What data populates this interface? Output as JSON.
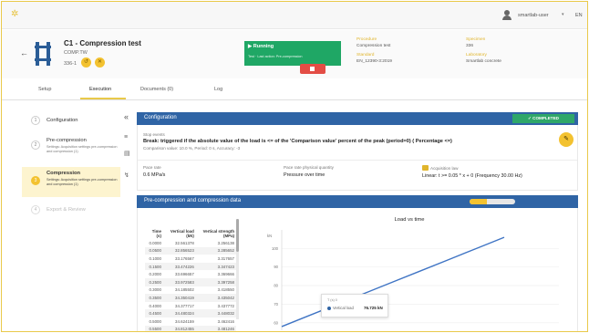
{
  "topbar": {
    "user": "smartlab-user",
    "lang": "EN"
  },
  "test": {
    "title": "C1 - Compression test",
    "code": "COMP.TW",
    "id": "336-1"
  },
  "run": {
    "state": "Running",
    "detail": "Test · Last action: Pre-compression",
    "color": "#1fa765"
  },
  "meta": [
    {
      "key": "Procedure",
      "value": "Compression test"
    },
    {
      "key": "Standard",
      "value": "EN_12390-3:2019"
    },
    {
      "key": "Specimen",
      "value": "336"
    },
    {
      "key": "Laboratory",
      "value": "Smartlab concrete"
    }
  ],
  "tabs": [
    {
      "label": "Setup"
    },
    {
      "label": "Execution"
    },
    {
      "label": "Documents (0)"
    },
    {
      "label": "Log"
    }
  ],
  "steps": [
    {
      "num": "1",
      "label": "Configuration",
      "desc": ""
    },
    {
      "num": "2",
      "label": "Pre-compression",
      "desc": "Settings: Acquisition settings pre-compression and compression (1)"
    },
    {
      "num": "3",
      "label": "Compression",
      "desc": "Settings: Acquisition settings pre-compression and compression (1)"
    },
    {
      "num": "4",
      "label": "Export & Review",
      "desc": ""
    }
  ],
  "config": {
    "header": "Configuration",
    "status": "COMPLETED",
    "stop_events_label": "Stop events",
    "stop_events_value": "Break: triggered if the absolute value of the load is <= of the 'Comparison value' percent of the peak (period=0) ( Percentage <=)",
    "stop_events_sub": "Comparison value: 10.0 %, Period: 0 s, Accuracy: -3",
    "pace_rate_label": "Pace rate",
    "pace_rate_value": "0.6 MPa/s",
    "pace_qty_label": "Pace rate physical quantity",
    "pace_qty_value": "Pressure over time",
    "acq_label": "Acquisition law",
    "acq_value": "Linear: t >= 0.05 * x + 0 (Frequency 30.00 Hz)"
  },
  "data_panel": {
    "header": "Pre-compression and compression data",
    "progress": 0.38,
    "columns": [
      "Time (s)",
      "Vertical load (kN)",
      "Vertical strength (MPa)"
    ],
    "rows": [
      [
        "0.0000",
        "32.561378",
        "3.256138"
      ],
      [
        "0.0500",
        "32.856523",
        "3.285652"
      ],
      [
        "0.1000",
        "33.176567",
        "3.317657"
      ],
      [
        "0.1500",
        "33.474226",
        "3.347423"
      ],
      [
        "0.2000",
        "33.696657",
        "3.369666"
      ],
      [
        "0.2500",
        "33.972583",
        "3.397258"
      ],
      [
        "0.3000",
        "34.185502",
        "3.418550"
      ],
      [
        "0.3500",
        "34.350419",
        "3.435042"
      ],
      [
        "0.4000",
        "34.377717",
        "3.437772"
      ],
      [
        "0.4500",
        "34.480324",
        "3.448032"
      ],
      [
        "0.5000",
        "34.624159",
        "3.462416"
      ],
      [
        "0.5500",
        "34.812455",
        "3.481246"
      ]
    ]
  },
  "chart_data": {
    "type": "line",
    "title": "Load vs time",
    "ylabel": "kN",
    "yticks": [
      60,
      70,
      80,
      90,
      100
    ],
    "ylim": [
      56,
      110
    ],
    "series": [
      {
        "name": "Vertical load",
        "x": [
          0,
          1,
          2,
          3,
          4,
          5,
          6,
          7,
          8
        ],
        "values": [
          58,
          64,
          70,
          76,
          82,
          88,
          94,
          100,
          106
        ]
      }
    ],
    "tooltip": {
      "title": "T (s) 0",
      "series": "Vertical load",
      "value": "76.725 kN"
    }
  }
}
